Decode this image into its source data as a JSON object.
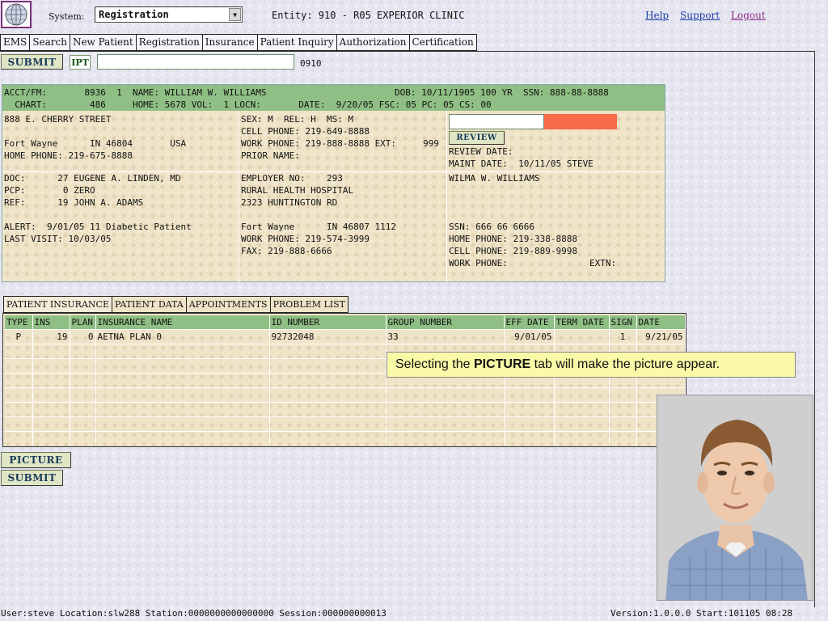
{
  "header": {
    "system_label": "System:",
    "system_value": "Registration",
    "entity": "Entity: 910 - R05 EXPERIOR CLINIC",
    "links": {
      "help": "Help",
      "support": "Support",
      "logout": "Logout"
    }
  },
  "menu": [
    "EMS",
    "Search",
    "New Patient",
    "Registration",
    "Insurance",
    "Patient Inquiry",
    "Authorization",
    "Certification"
  ],
  "toolbar": {
    "submit_label": "SUBMIT",
    "ipt_label": "IPT",
    "ipt_value": "",
    "code": "0910"
  },
  "patient": {
    "acct_line": "ACCT/FM:       8936  1  NAME: WILLIAM W. WILLIAMS",
    "dob_line": "DOB: 10/11/1905 100 YR  SSN: 888-88-8888",
    "chart_line": "  CHART:        486     HOME: 5678 VOL:  1 LOCN:       DATE:  9/20/05 FSC: 05 PC: 05 CS: 00",
    "address": {
      "street": "888 E. CHERRY STREET",
      "city_line": "Fort Wayne      IN 46804       USA",
      "home_phone": "HOME PHONE: 219-675-8888"
    },
    "contact": {
      "sex_line": "SEX: M  REL: H  MS: M",
      "cell_phone": "CELL PHONE: 219-649-8888",
      "work_phone": "WORK PHONE: 219-888-8888 EXT:     999",
      "prior_name": "PRIOR NAME:"
    },
    "review": {
      "button_label": "REVIEW",
      "review_date": "REVIEW DATE:",
      "maint_date": "MAINT DATE:  10/11/05 STEVE"
    },
    "providers": {
      "doc": "DOC:      27 EUGENE A. LINDEN, MD",
      "pcp": "PCP:       0 ZERO",
      "ref": "REF:      19 JOHN A. ADAMS",
      "alert": "ALERT:  9/01/05 11 Diabetic Patient",
      "last_visit": "LAST VISIT: 10/03/05"
    },
    "employer": {
      "employer_no": "EMPLOYER NO:    293",
      "name": "RURAL HEALTH HOSPITAL",
      "address": "2323 HUNTINGTON RD",
      "city_line": "Fort Wayne      IN 46807 1112",
      "work_phone": "WORK PHONE: 219-574-3999",
      "fax": "FAX: 219-888-6666"
    },
    "guarantor": {
      "name": "WILMA W. WILLIAMS",
      "ssn": "SSN: 666 66 6666",
      "home_phone": "HOME PHONE: 219-338-8888",
      "cell_phone": "CELL PHONE: 219-889-9998",
      "work_phone": "WORK PHONE:",
      "extn": "EXTN:"
    }
  },
  "subtabs": [
    "PATIENT INSURANCE",
    "PATIENT DATA",
    "APPOINTMENTS",
    "PROBLEM LIST"
  ],
  "insurance": {
    "columns": [
      "TYPE",
      "INS",
      "PLAN",
      "INSURANCE NAME",
      "ID NUMBER",
      "GROUP NUMBER",
      "EFF DATE",
      "TERM DATE",
      "SIGN",
      "DATE"
    ],
    "rows": [
      [
        "P",
        "19",
        "0",
        "AETNA PLAN 0",
        "92732048",
        "33",
        "9/01/05",
        "",
        "1",
        "9/21/05"
      ]
    ]
  },
  "tooltip": {
    "before": "Selecting the ",
    "bold": "PICTURE",
    "after": " tab will make the picture appear."
  },
  "buttons": {
    "picture": "PICTURE",
    "submit": "SUBMIT"
  },
  "status": {
    "left": "User:steve Location:slw288 Station:0000000000000000 Session:000000000013",
    "right": "Version:1.0.0.0  Start:101105 08:28"
  }
}
